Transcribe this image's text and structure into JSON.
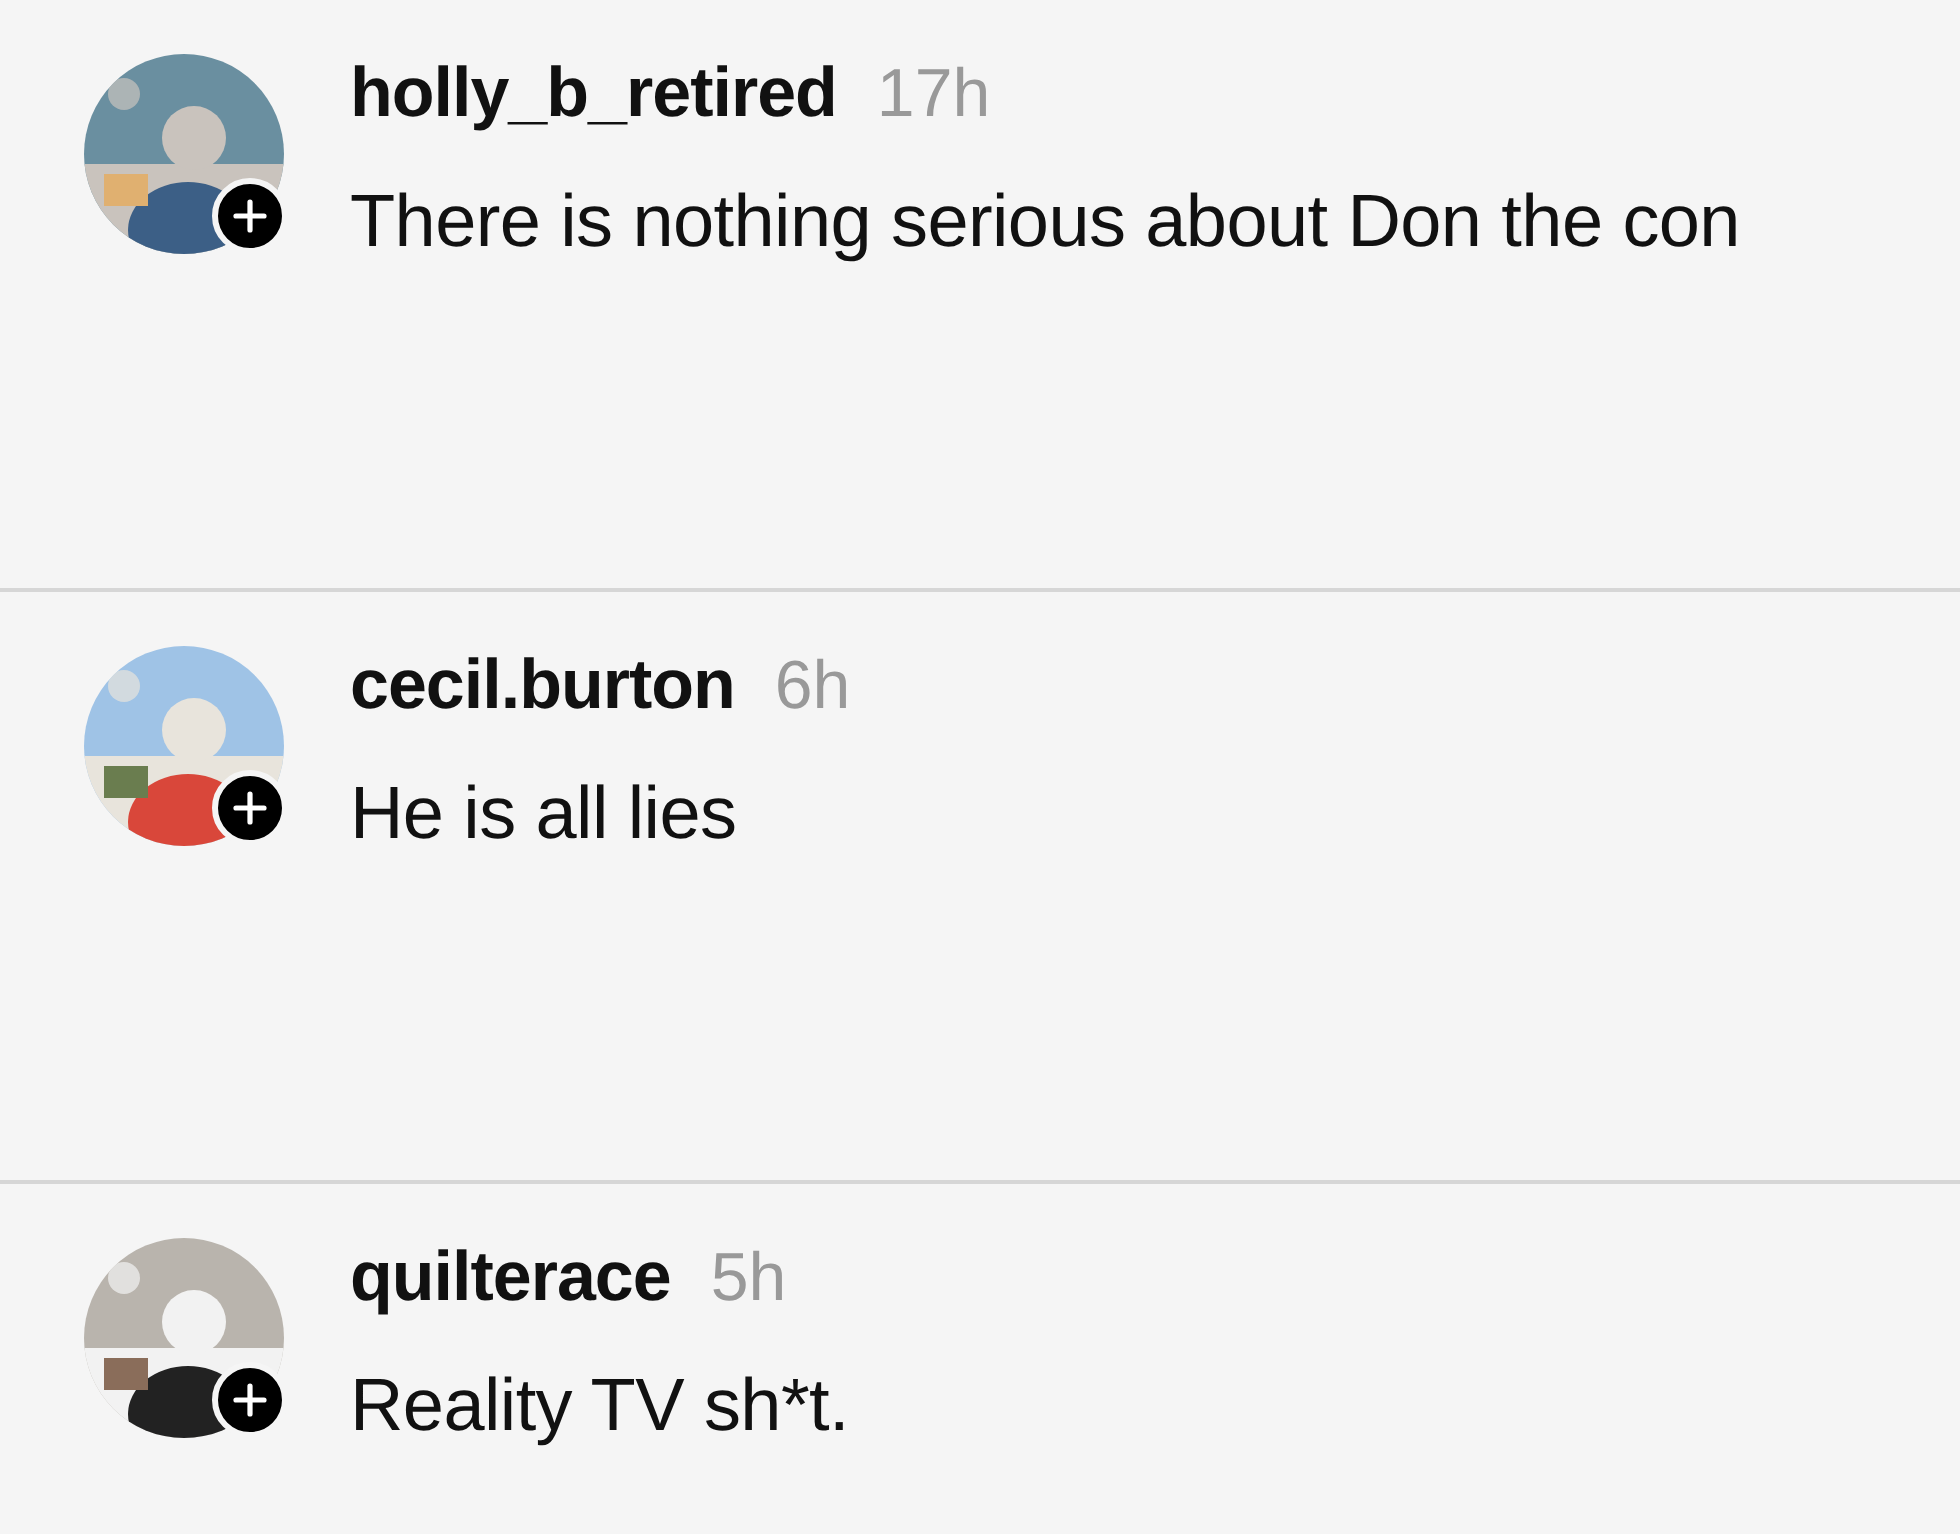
{
  "comments": [
    {
      "username": "holly_b_retired",
      "time": "17h",
      "text": "There is nothing serious about Don the con"
    },
    {
      "username": "cecil.burton",
      "time": "6h",
      "text": "He is all lies"
    },
    {
      "username": "quilterace",
      "time": "5h",
      "text": "Reality TV sh*t."
    }
  ]
}
